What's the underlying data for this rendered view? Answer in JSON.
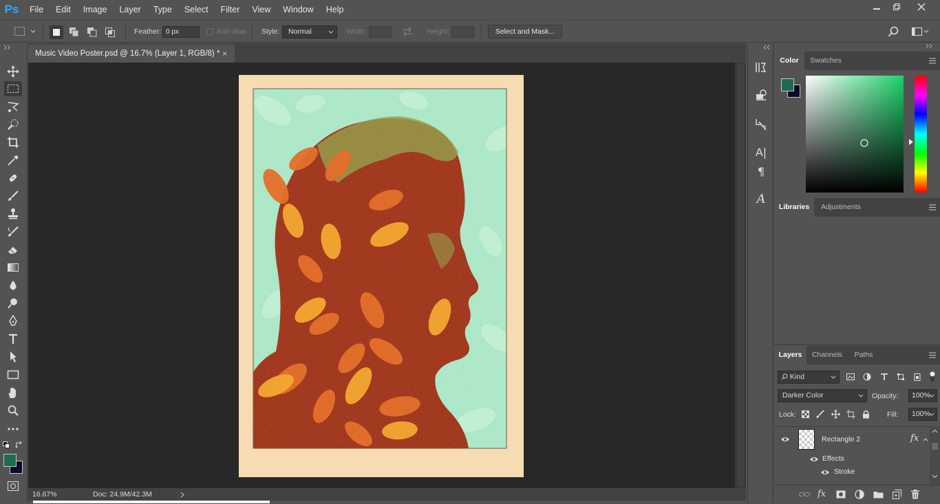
{
  "app": {
    "logo": "Ps"
  },
  "menu": [
    "File",
    "Edit",
    "Image",
    "Layer",
    "Type",
    "Select",
    "Filter",
    "View",
    "Window",
    "Help"
  ],
  "window_controls": {
    "minimize": "minimize-icon",
    "restore": "restore-icon",
    "close": "close-icon"
  },
  "options": {
    "feather_label": "Feather:",
    "feather_value": "0 px",
    "antialias_label": "Anti-alias",
    "style_label": "Style:",
    "style_value": "Normal",
    "width_label": "Width:",
    "height_label": "Height:",
    "select_mask_button": "Select and Mask..."
  },
  "document": {
    "tab_title": "Music Video Poster.psd @ 16.7% (Layer 1, RGB/8) *",
    "close_glyph": "×",
    "zoom": "16.67%",
    "doc_info": "Doc: 24.9M/42.3M",
    "poster_border_color": "#f6dbb3",
    "poster_bg_color": "#a7e6c4",
    "silhouette_color": "#9a2a0e"
  },
  "colors": {
    "foreground": "#1f6b4f",
    "background": "#0f0a2a",
    "accent": "#31a8ff"
  },
  "panels": {
    "color": {
      "tabs": [
        "Color",
        "Swatches"
      ],
      "active": 0
    },
    "libraries": {
      "tabs": [
        "Libraries",
        "Adjustments"
      ],
      "active": 0
    },
    "layers": {
      "tabs": [
        "Layers",
        "Channels",
        "Paths"
      ],
      "active": 0,
      "filter_kind": "Kind",
      "blend_mode": "Darker Color",
      "opacity_label": "Opacity:",
      "opacity_value": "100%",
      "lock_label": "Lock:",
      "fill_label": "Fill:",
      "fill_value": "100%",
      "layer_name": "Rectangle 2",
      "fx_glyph": "fx",
      "effects_label": "Effects",
      "stroke_label": "Stroke"
    }
  }
}
